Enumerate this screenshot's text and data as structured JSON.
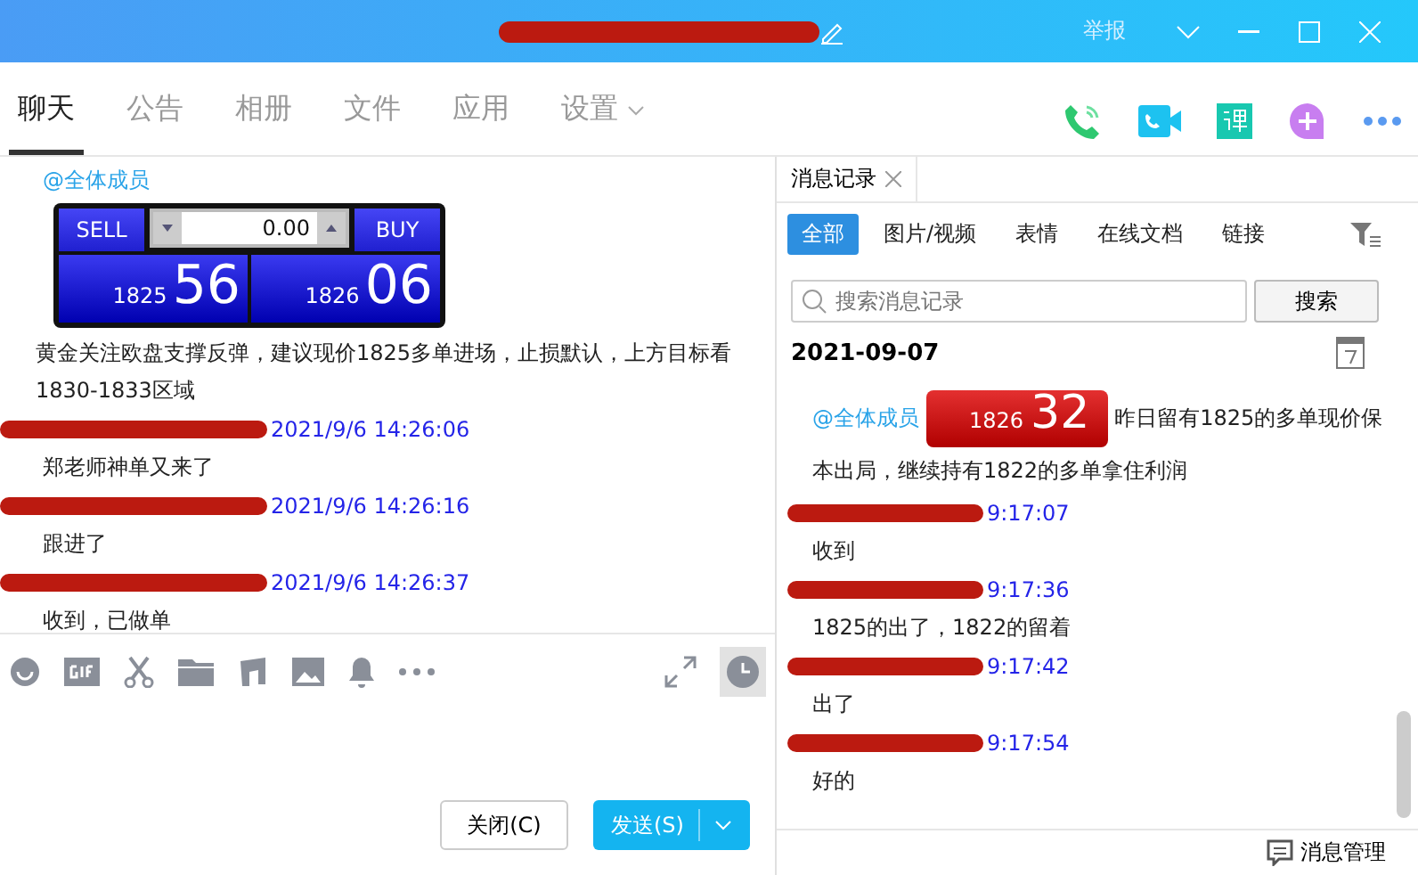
{
  "window": {
    "report": "举报"
  },
  "tabs": [
    {
      "label": "聊天",
      "selected": true
    },
    {
      "label": "公告",
      "selected": false
    },
    {
      "label": "相册",
      "selected": false
    },
    {
      "label": "文件",
      "selected": false
    },
    {
      "label": "应用",
      "selected": false
    },
    {
      "label": "设置",
      "selected": false,
      "dropdown": true
    }
  ],
  "chat": {
    "mention": "@全体成员",
    "quote": {
      "sell": "SELL",
      "value": "0.00",
      "buy": "BUY",
      "bid_big": "1825",
      "bid_small": "56",
      "ask_big": "1826",
      "ask_small": "06"
    },
    "lead_text": "黄金关注欧盘支撑反弹，建议现价1825多单进场，止损默认，上方目标看1830-1833区域",
    "messages": [
      {
        "time": "2021/9/6 14:26:06",
        "text": "郑老师神单又来了"
      },
      {
        "time": "2021/9/6 14:26:16",
        "text": "跟进了"
      },
      {
        "time": "2021/9/6 14:26:37",
        "text": "收到，已做单"
      }
    ]
  },
  "input": {
    "close": "关闭(C)",
    "send": "发送(S)"
  },
  "history": {
    "tab": "消息记录",
    "filters": [
      {
        "label": "全部",
        "selected": true
      },
      {
        "label": "图片/视频",
        "selected": false
      },
      {
        "label": "表情",
        "selected": false
      },
      {
        "label": "在线文档",
        "selected": false
      },
      {
        "label": "链接",
        "selected": false
      }
    ],
    "search": {
      "placeholder": "搜索消息记录",
      "button": "搜索"
    },
    "date": "2021-09-07",
    "mention": "@全体成员",
    "quote": {
      "big": "1826",
      "small": "32"
    },
    "lead_text": "昨日留有1825的多单现价保本出局，继续持有1822的多单拿住利润",
    "messages": [
      {
        "time": "9:17:07",
        "text": "收到"
      },
      {
        "time": "9:17:36",
        "text": "1825的出了，1822的留着"
      },
      {
        "time": "9:17:42",
        "text": "出了"
      },
      {
        "time": "9:17:54",
        "text": "好的"
      }
    ],
    "manage": "消息管理"
  }
}
